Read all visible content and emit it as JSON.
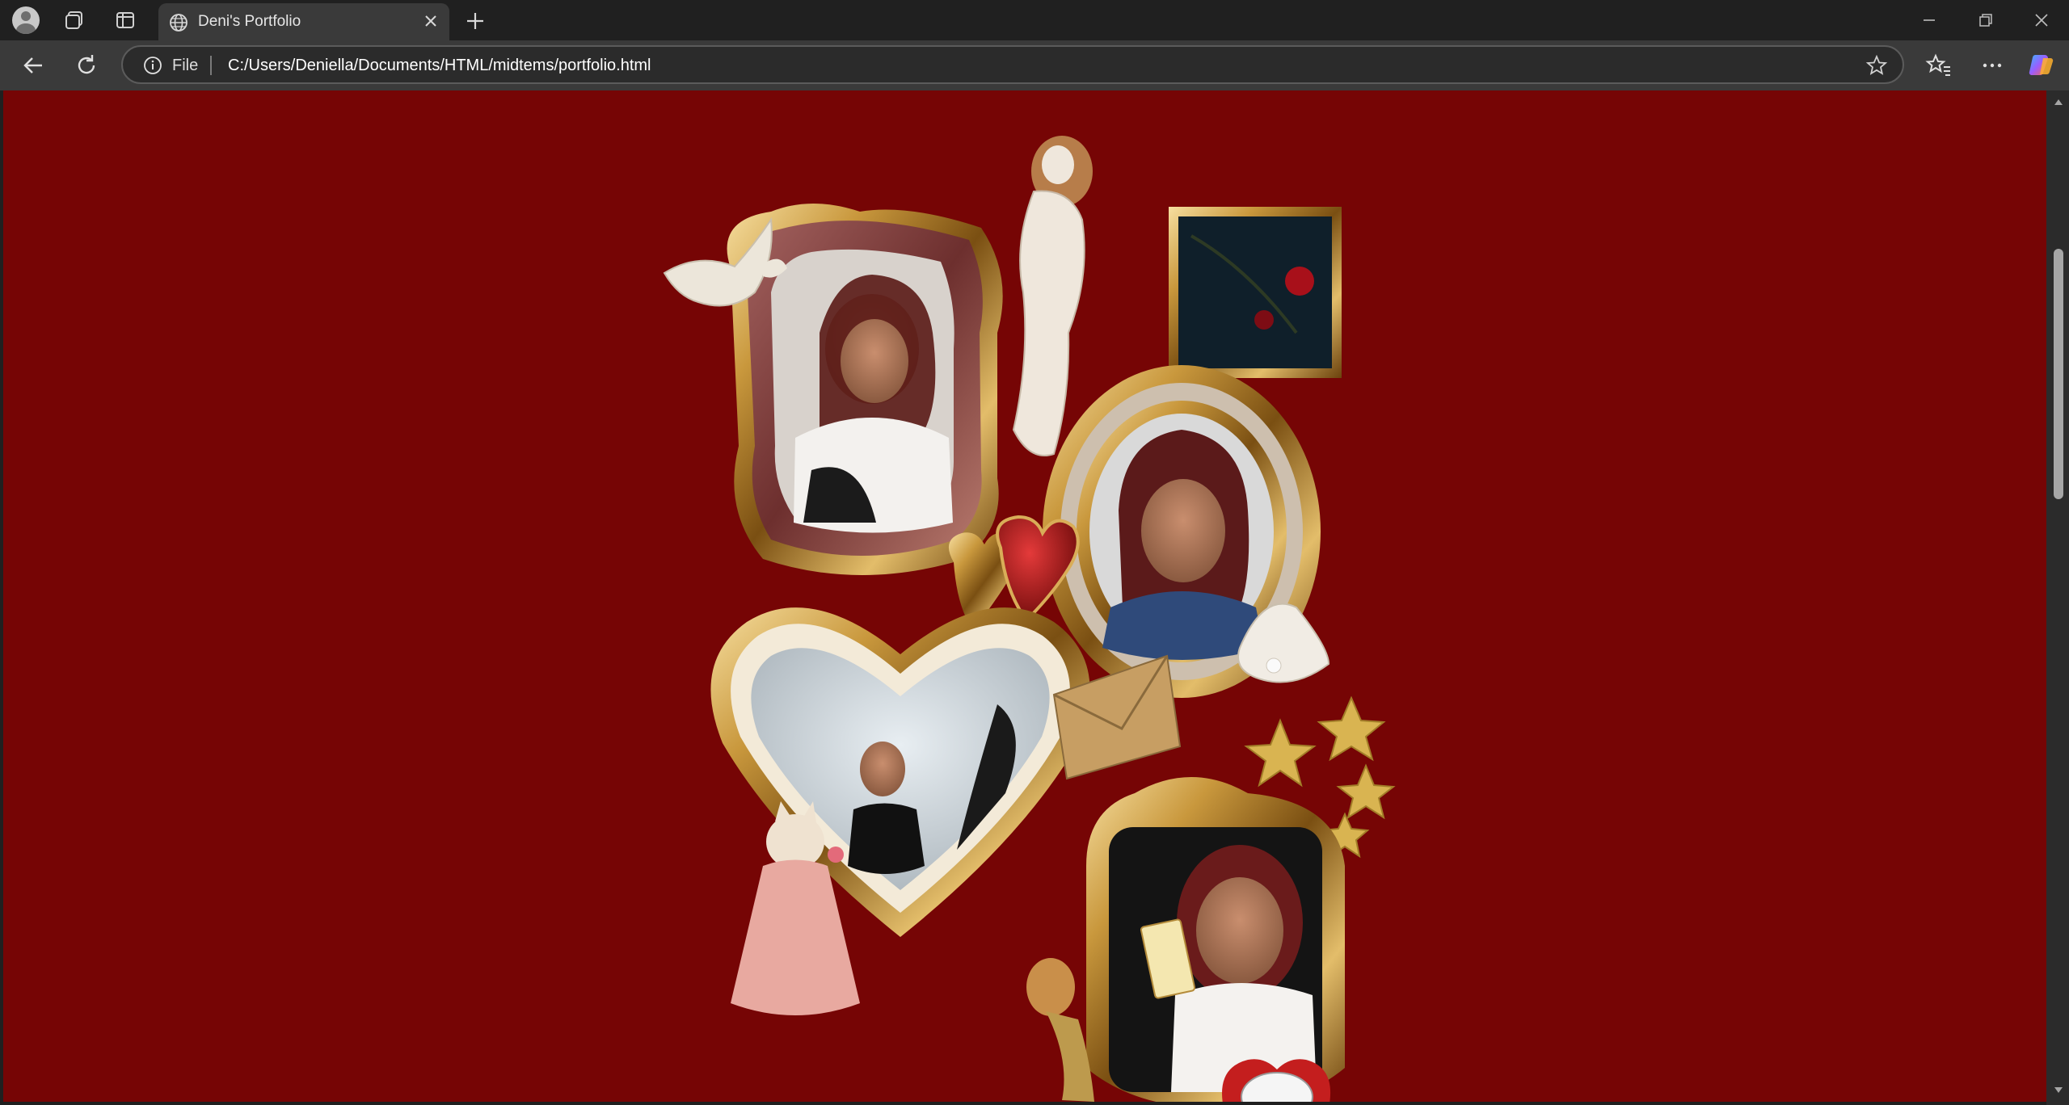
{
  "browser": {
    "tab": {
      "title": "Deni's Portfolio"
    },
    "address": {
      "scheme_label": "File",
      "url": "C:/Users/Deniella/Documents/HTML/midtems/portfolio.html"
    }
  },
  "colors": {
    "page_background": "#760505",
    "chrome_dark": "#202020",
    "chrome_toolbar": "#3a3a3a",
    "gold": "#c9983d"
  },
  "page": {
    "collage": [
      {
        "name": "photo-frame-ornate-top-left",
        "icon": "portrait-photo"
      },
      {
        "name": "photo-frame-oval-right",
        "icon": "portrait-photo"
      },
      {
        "name": "photo-frame-heart",
        "icon": "portrait-photo"
      },
      {
        "name": "photo-frame-bottom-right",
        "icon": "portrait-photo"
      },
      {
        "name": "dove-sticker",
        "icon": "dove"
      },
      {
        "name": "venus-statue-sticker",
        "icon": "statue"
      },
      {
        "name": "cherry-painting-sticker",
        "icon": "cherry-painting"
      },
      {
        "name": "heart-lockets-sticker",
        "icon": "heart-locket"
      },
      {
        "name": "seashell-sticker",
        "icon": "seashell"
      },
      {
        "name": "envelope-sticker",
        "icon": "envelope"
      },
      {
        "name": "gold-stars-sticker",
        "icon": "star"
      },
      {
        "name": "cat-in-dress-sticker",
        "icon": "cat"
      },
      {
        "name": "mermaid-sticker",
        "icon": "mermaid"
      },
      {
        "name": "alarm-clock-sticker",
        "icon": "alarm-clock"
      }
    ]
  }
}
